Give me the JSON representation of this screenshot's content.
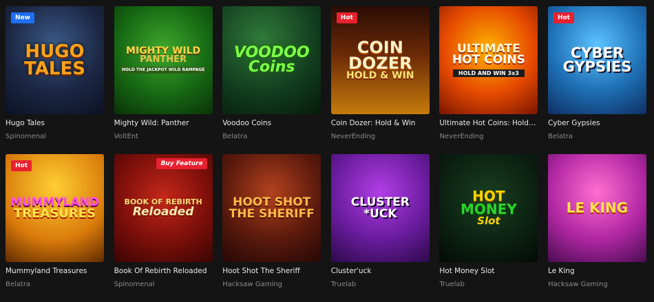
{
  "badge_colors": {
    "New": "#1e6ff2",
    "Hot": "#e8212f",
    "Buy Feature": "#e8212f"
  },
  "games": [
    {
      "title": "Hugo Tales",
      "provider": "Spinomenal",
      "badge": "New",
      "theme": "hugo",
      "art": {
        "line1": "HUGO",
        "line2": "TALES",
        "sub": ""
      }
    },
    {
      "title": "Mighty Wild: Panther",
      "provider": "VoltEnt",
      "badge": "",
      "theme": "panther",
      "art": {
        "line1": "MIGHTY WILD",
        "line2": "PANTHER",
        "sub": "HOLD THE JACKPOT WILD RAMPAGE"
      }
    },
    {
      "title": "Voodoo Coins",
      "provider": "Belatra",
      "badge": "",
      "theme": "voodoo",
      "art": {
        "line1": "VOODOO",
        "line2": "Coins",
        "sub": ""
      }
    },
    {
      "title": "Coin Dozer: Hold & Win",
      "provider": "NeverEnding",
      "badge": "Hot",
      "theme": "coin",
      "art": {
        "line1": "COIN DOZER",
        "line2": "HOLD & WIN",
        "sub": ""
      }
    },
    {
      "title": "Ultimate Hot Coins: Hold & Win",
      "provider": "NeverEnding",
      "badge": "",
      "theme": "ultimate",
      "art": {
        "line1": "ULTIMATE",
        "line2": "HOT COINS",
        "sub": "HOLD AND WIN 3x3"
      }
    },
    {
      "title": "Cyber Gypsies",
      "provider": "Belatra",
      "badge": "Hot",
      "theme": "cyber",
      "art": {
        "line1": "CYBER",
        "line2": "GYPSIES",
        "sub": ""
      }
    },
    {
      "title": "Mummyland Treasures",
      "provider": "Belatra",
      "badge": "Hot",
      "theme": "mummy",
      "art": {
        "line1": "MUMMYLAND",
        "line2": "TREASURES",
        "sub": ""
      }
    },
    {
      "title": "Book Of Rebirth Reloaded",
      "provider": "Spinomenal",
      "badge": "Buy Feature",
      "theme": "book",
      "art": {
        "line1": "BOOK OF REBIRTH",
        "line2": "Reloaded",
        "sub": ""
      }
    },
    {
      "title": "Hoot Shot The Sheriff",
      "provider": "Hacksaw Gaming",
      "badge": "",
      "theme": "hoot",
      "art": {
        "line1": "HOOT SHOT",
        "line2": "THE SHERIFF",
        "sub": ""
      }
    },
    {
      "title": "Cluster'uck",
      "provider": "Truelab",
      "badge": "",
      "theme": "cluster",
      "art": {
        "line1": "CLUSTER",
        "line2": "*UCK",
        "sub": ""
      }
    },
    {
      "title": "Hot Money Slot",
      "provider": "Truelab",
      "badge": "",
      "theme": "money",
      "art": {
        "line1": "HOT",
        "line2": "MONEY",
        "sub": "Slot"
      }
    },
    {
      "title": "Le King",
      "provider": "Hacksaw Gaming",
      "badge": "",
      "theme": "leking",
      "art": {
        "line1": "LE KING",
        "line2": "",
        "sub": ""
      }
    }
  ]
}
